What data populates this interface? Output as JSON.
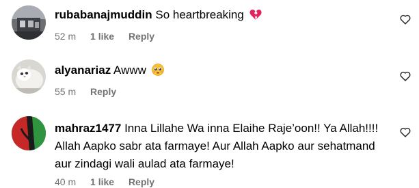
{
  "comments": [
    {
      "username": "rubabanajmuddin",
      "text": "So heartbreaking",
      "emoji_icon": "broken-heart-icon",
      "time": "52 m",
      "likes": "1 like",
      "reply": "Reply"
    },
    {
      "username": "alyanariaz",
      "text": "Awww",
      "emoji_icon": "pleading-face-icon",
      "time": "55 m",
      "likes": "",
      "reply": "Reply"
    },
    {
      "username": "mahraz1477",
      "text_line_1": "Inna Lillahe Wa inna Elaihe Raje’oon!! Ya Allah!!!!",
      "text_line_2": "Allah Aapko sabr ata farmaye! Aur Allah Aapko aur sehatmand",
      "text_line_3": "aur zindagi wali aulad ata farmaye!",
      "time": "40 m",
      "likes": "1 like",
      "reply": "Reply"
    }
  ],
  "colors": {
    "meta_text": "#737373",
    "broken_heart": "#e0245e"
  },
  "icons": {
    "like": "heart-outline-icon"
  }
}
